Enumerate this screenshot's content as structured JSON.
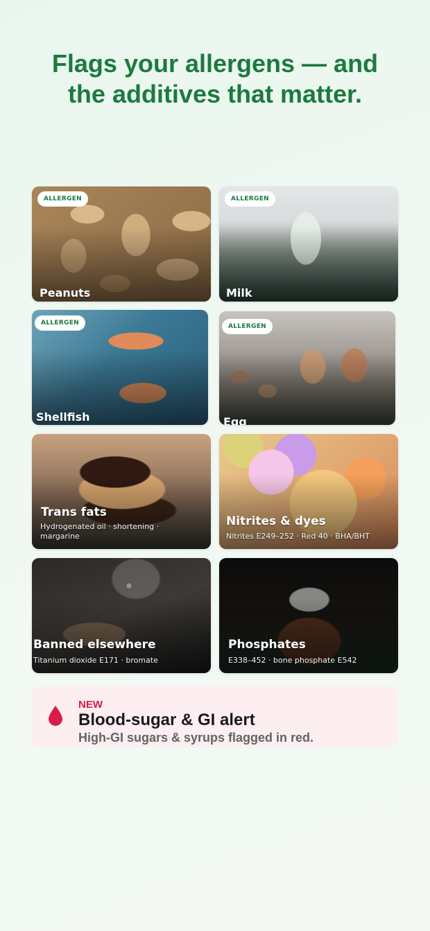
{
  "headline": {
    "line1": "Flags your allergens — and",
    "line2": "the additives that matter."
  },
  "colors": {
    "brand_green": "#1c7a3e",
    "alert_red": "#d81b47",
    "alert_bg": "#fdeef1"
  },
  "allergens": [
    {
      "badge": "ALLERGEN",
      "label": "Peanuts",
      "image": "peanuts-photo"
    },
    {
      "badge": "ALLERGEN",
      "label": "Milk",
      "image": "milk-glass-photo"
    },
    {
      "badge": "ALLERGEN",
      "label": "Shellfish",
      "image": "shrimp-photo"
    },
    {
      "badge": "ALLERGEN",
      "label": "Egg",
      "image": "eggs-photo"
    }
  ],
  "additives": [
    {
      "label": "Trans fats",
      "detail": "Hydrogenated oil · shortening · margarine",
      "image": "donut-photo"
    },
    {
      "label": "Nitrites & dyes",
      "detail": "Nitrites E249–252 · Red 40 · BHA/BHT",
      "image": "candy-photo"
    },
    {
      "label": "Banned elsewhere",
      "detail": "Titanium dioxide E171 · bromate",
      "image": "bread-photo"
    },
    {
      "label": "Phosphates",
      "detail": "E338–452 · bone phosphate E542",
      "image": "cola-photo"
    }
  ],
  "alert": {
    "icon": "blood-drop-icon",
    "tag": "NEW",
    "title": "Blood-sugar & GI alert",
    "description": "High-GI sugars & syrups flagged in red."
  }
}
